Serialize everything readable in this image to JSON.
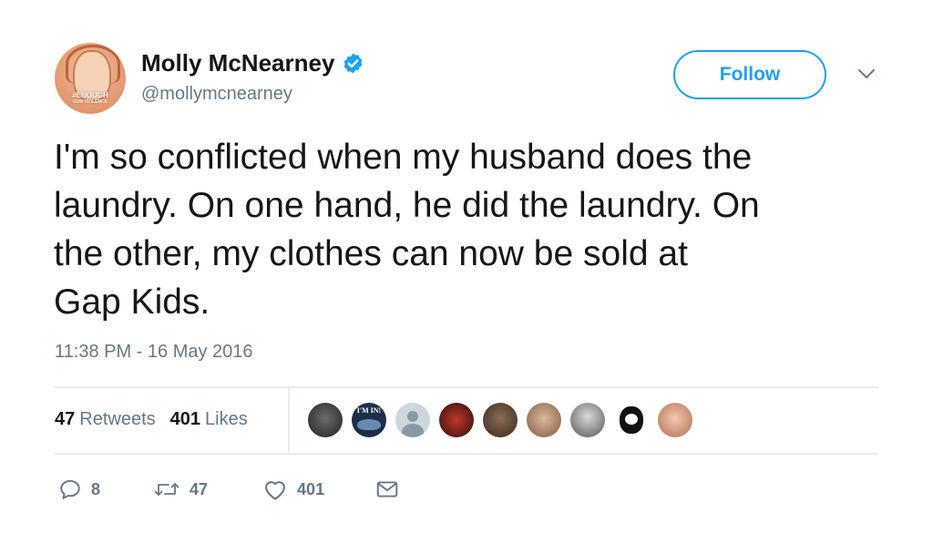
{
  "author": {
    "name": "Molly McNearney",
    "handle": "@mollymcnearney",
    "avatar_badge": "#ENOUGH",
    "avatar_badge_sub": "GUN VIOLENCE",
    "verified_icon": "verified-badge-icon"
  },
  "follow_label": "Follow",
  "tweet_text": "I'm so conflicted when my husband does the\nlaundry. On one hand, he did the laundry. On\nthe other, my clothes can now be sold at\nGap Kids.",
  "timestamp": "11:38 PM - 16 May 2016",
  "stats": {
    "retweets_count": "47",
    "retweets_label": "Retweets",
    "likes_count": "401",
    "likes_label": "Likes"
  },
  "likers_avatar_badge": "I'M IN!",
  "actions": {
    "reply_count": "8",
    "retweet_count": "47",
    "like_count": "401"
  },
  "colors": {
    "accent": "#1da1f2",
    "text": "#14171a",
    "secondary": "#657786",
    "divider": "#e6ecf0"
  }
}
